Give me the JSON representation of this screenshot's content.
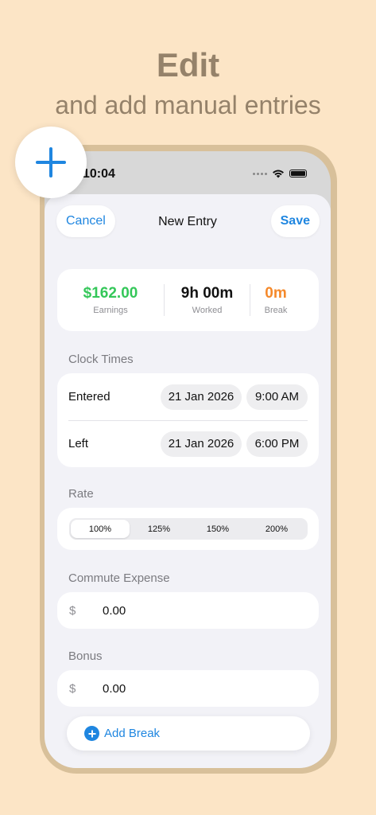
{
  "promo": {
    "headline": "Edit",
    "subheadline": "and add manual entries"
  },
  "status_bar": {
    "time": "10:04"
  },
  "nav": {
    "cancel_label": "Cancel",
    "title": "New Entry",
    "save_label": "Save"
  },
  "summary": {
    "earnings": {
      "value": "$162.00",
      "label": "Earnings",
      "color": "#34c759"
    },
    "worked": {
      "value": "9h 00m",
      "label": "Worked",
      "color": "#111111"
    },
    "break": {
      "value": "0m",
      "label": "Break",
      "color": "#f5892b"
    }
  },
  "clock_times": {
    "section_label": "Clock Times",
    "entered": {
      "label": "Entered",
      "date": "21 Jan 2026",
      "time": "9:00 AM"
    },
    "left": {
      "label": "Left",
      "date": "21 Jan 2026",
      "time": "6:00 PM"
    }
  },
  "rate": {
    "section_label": "Rate",
    "options": [
      "100%",
      "125%",
      "150%",
      "200%"
    ],
    "selected": "100%"
  },
  "commute": {
    "section_label": "Commute Expense",
    "currency": "$",
    "value": "0.00"
  },
  "bonus": {
    "section_label": "Bonus",
    "currency": "$",
    "value": "0.00"
  },
  "add_break": {
    "label": "Add Break",
    "icon": "plus-circle-icon"
  },
  "fab": {
    "icon": "plus-icon"
  },
  "colors": {
    "accent": "#1f86e0",
    "background": "#fce5c6",
    "frame": "#d8c09a"
  }
}
